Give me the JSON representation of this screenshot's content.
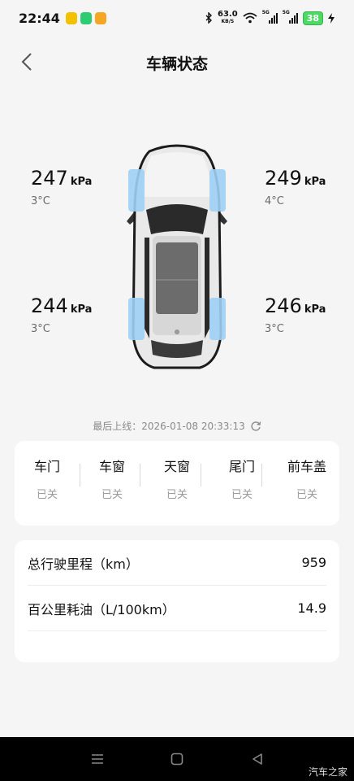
{
  "status_bar": {
    "time": "22:44",
    "net_speed": "63.0",
    "net_unit": "KB/S",
    "signal1_tag": "5G",
    "signal2_tag": "5G",
    "battery": "38"
  },
  "header": {
    "title": "车辆状态"
  },
  "tires": {
    "front_left": {
      "pressure": "247",
      "unit": "kPa",
      "temp": "3°C"
    },
    "front_right": {
      "pressure": "249",
      "unit": "kPa",
      "temp": "4°C"
    },
    "rear_left": {
      "pressure": "244",
      "unit": "kPa",
      "temp": "3°C"
    },
    "rear_right": {
      "pressure": "246",
      "unit": "kPa",
      "temp": "3°C"
    }
  },
  "last_online": "最后上线：2026-01-08 20:33:13",
  "doors": [
    {
      "label": "车门",
      "state": "已关"
    },
    {
      "label": "车窗",
      "state": "已关"
    },
    {
      "label": "天窗",
      "state": "已关"
    },
    {
      "label": "尾门",
      "state": "已关"
    },
    {
      "label": "前车盖",
      "state": "已关"
    }
  ],
  "stats": [
    {
      "label": "总行驶里程（km）",
      "value": "959"
    },
    {
      "label": "百公里耗油（L/100km）",
      "value": "14.9"
    }
  ],
  "watermark": "汽车之家",
  "colors": {
    "tire_highlight": "#9fd0f5",
    "battery": "#4cd964"
  }
}
